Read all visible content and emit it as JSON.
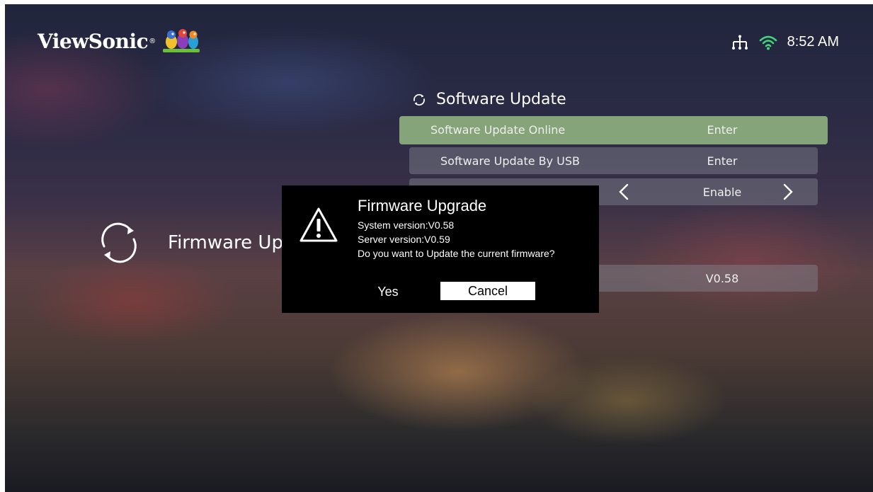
{
  "header": {
    "brand": "ViewSonic",
    "brand_mark": "®",
    "time": "8:52 AM",
    "icons": [
      "ethernet-icon",
      "wifi-icon"
    ],
    "wifi_color": "#3fd47a"
  },
  "left_panel": {
    "icon": "refresh-icon",
    "label": "Firmware Up"
  },
  "settings": {
    "section_title": "Software Update",
    "section_icon": "refresh-icon",
    "items": [
      {
        "label": "Software Update Online",
        "value": "Enter",
        "selected": true
      },
      {
        "label": "Software Update By USB",
        "value": "Enter",
        "selected": false
      },
      {
        "label": "",
        "value": "Enable",
        "selected": false,
        "has_arrows": true
      },
      {
        "label": "",
        "value": "V0.58",
        "selected": false
      }
    ],
    "selected_color": "#86a47a"
  },
  "dialog": {
    "icon": "warning-icon",
    "title": "Firmware Upgrade",
    "system_version": "System version:V0.58",
    "server_version": "Server version:V0.59",
    "question": "Do you want to Update the current firmware?",
    "yes_label": "Yes",
    "cancel_label": "Cancel"
  }
}
